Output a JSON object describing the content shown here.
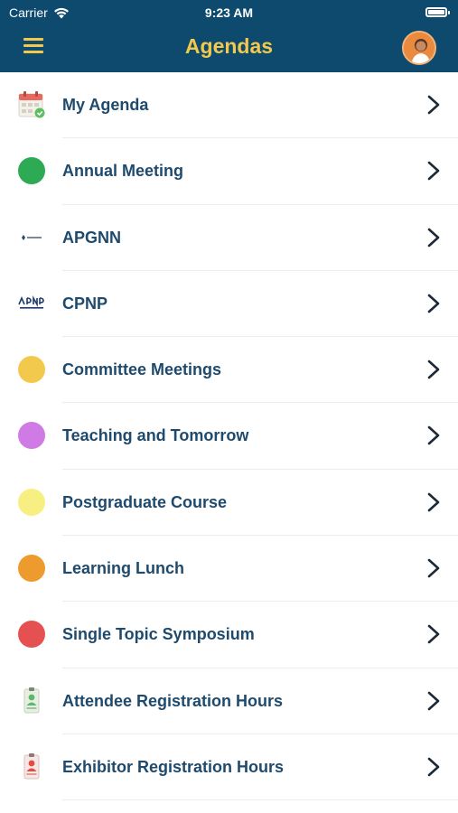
{
  "status": {
    "carrier": "Carrier",
    "time": "9:23 AM"
  },
  "header": {
    "title": "Agendas"
  },
  "agendas": [
    {
      "label": "My Agenda",
      "icon": "calendar-icon"
    },
    {
      "label": "Annual Meeting",
      "icon": "dot-icon",
      "color": "#2eaa55"
    },
    {
      "label": "APGNN",
      "icon": "apgnn-logo"
    },
    {
      "label": "CPNP",
      "icon": "cpnp-logo"
    },
    {
      "label": "Committee Meetings",
      "icon": "dot-icon",
      "color": "#f2c94c"
    },
    {
      "label": "Teaching and Tomorrow",
      "icon": "dot-icon",
      "color": "#d07ae6"
    },
    {
      "label": "Postgraduate Course",
      "icon": "dot-icon",
      "color": "#f8ef82"
    },
    {
      "label": "Learning Lunch",
      "icon": "dot-icon",
      "color": "#ee9b2e"
    },
    {
      "label": "Single Topic Symposium",
      "icon": "dot-icon",
      "color": "#e55151"
    },
    {
      "label": "Attendee Registration Hours",
      "icon": "attendee-badge-icon"
    },
    {
      "label": "Exhibitor Registration Hours",
      "icon": "exhibitor-badge-icon"
    }
  ]
}
